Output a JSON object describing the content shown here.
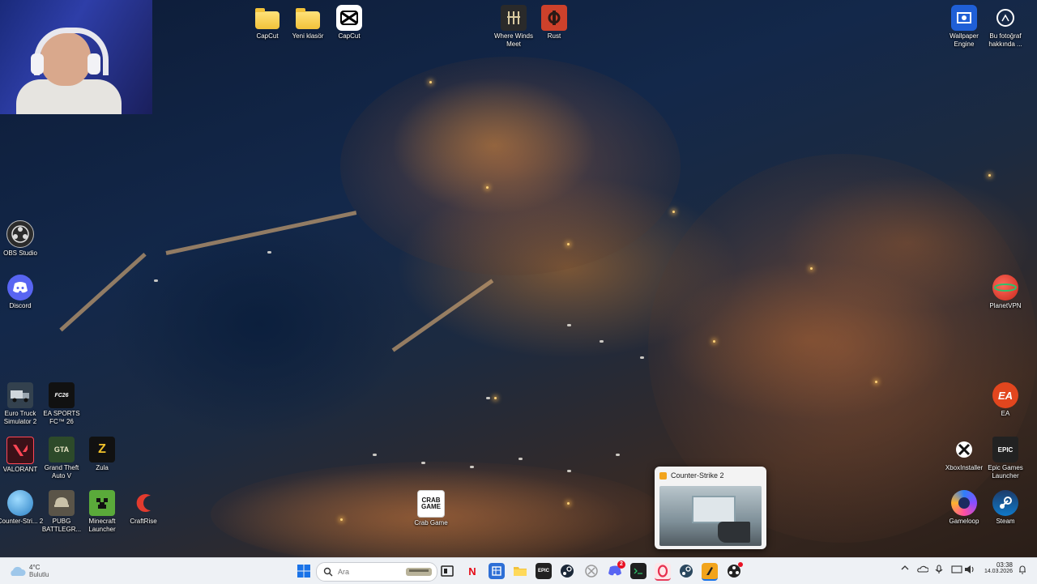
{
  "desktop": {
    "wallpaper": "night aerial harbor town",
    "icons_top": [
      {
        "label": "CapCut",
        "icon": "folder-icon"
      },
      {
        "label": "Yeni klasör",
        "icon": "folder-icon"
      },
      {
        "label": "CapCut",
        "icon": "capcut-icon"
      },
      {
        "label": "Where Winds Meet",
        "icon": "where-winds-meet-icon"
      },
      {
        "label": "Rust",
        "icon": "rust-icon"
      }
    ],
    "icons_left": [
      {
        "label": "OBS Studio",
        "icon": "obs-icon"
      },
      {
        "label": "Discord",
        "icon": "discord-icon"
      },
      {
        "label": "Euro Truck Simulator 2",
        "icon": "truck-icon"
      },
      {
        "label": "EA SPORTS FC™ 26",
        "icon": "fc26-icon"
      },
      {
        "label": "VALORANT",
        "icon": "valorant-icon"
      },
      {
        "label": "Grand Theft Auto V",
        "icon": "gta-icon"
      },
      {
        "label": "Zula",
        "icon": "zula-icon"
      },
      {
        "label": "Counter-Stri... 2",
        "icon": "globe-icon"
      },
      {
        "label": "PUBG BATTLEGR...",
        "icon": "pubg-icon"
      },
      {
        "label": "Minecraft Launcher",
        "icon": "minecraft-icon"
      },
      {
        "label": "CraftRise",
        "icon": "craftrise-icon"
      },
      {
        "label": "Crab Game",
        "icon": "crab-game-icon"
      }
    ],
    "icons_right": [
      {
        "label": "Wallpaper Engine",
        "icon": "wallpaper-engine-icon"
      },
      {
        "label": "Bu fotoğraf hakkında ...",
        "icon": "info-camera-icon"
      },
      {
        "label": "PlanetVPN",
        "icon": "planetvpn-icon"
      },
      {
        "label": "EA",
        "icon": "ea-icon"
      },
      {
        "label": "XboxInstaller",
        "icon": "xbox-icon"
      },
      {
        "label": "Epic Games Launcher",
        "icon": "epic-icon"
      },
      {
        "label": "Gameloop",
        "icon": "gameloop-icon"
      },
      {
        "label": "Steam",
        "icon": "steam-icon"
      }
    ],
    "crab_game_logo": "CRAB GAME"
  },
  "preview": {
    "title": "Counter-Strike 2"
  },
  "taskbar": {
    "weather_temp": "4°C",
    "weather_desc": "Bulutlu",
    "search_placeholder": "Ara",
    "netflix_glyph": "N",
    "epic_glyph": "EPIC",
    "time": "03:38",
    "date": "14.03.2026",
    "discord_badge": "2"
  },
  "colors": {
    "taskbar_bg": "#eef1f5",
    "accent_windows": "#1a73e8",
    "netflix": "#e50914",
    "discord": "#5865f2"
  }
}
